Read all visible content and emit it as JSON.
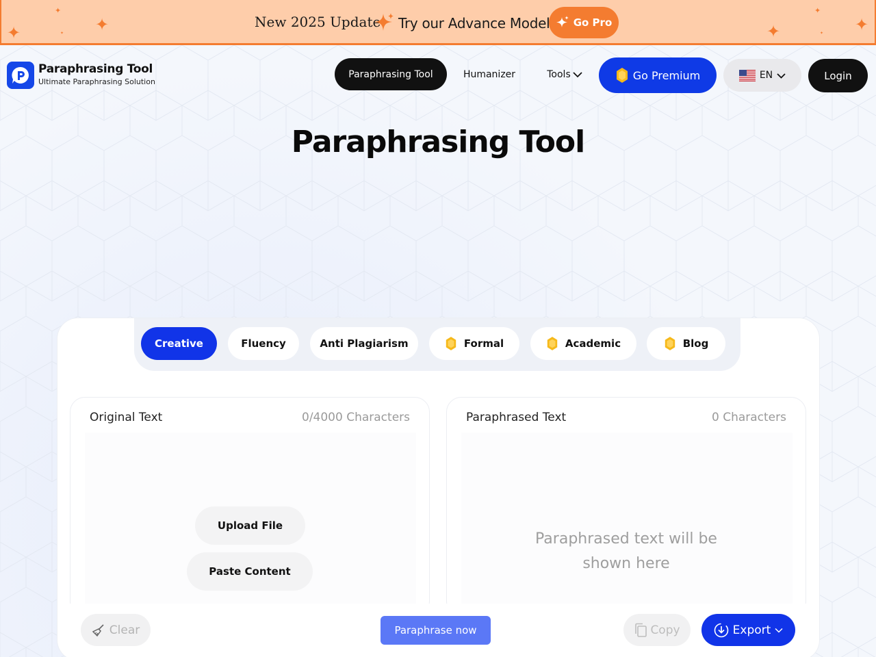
{
  "promo": {
    "update_text": "New 2025 Update:",
    "cta_text": "Try our Advance Model",
    "go_pro_label": "Go Pro"
  },
  "brand": {
    "title": "Paraphrasing Tool",
    "subtitle": "Ultimate Paraphrasing Solution",
    "logo_icon": "chat-bubble-p-icon"
  },
  "nav": {
    "items": [
      {
        "label": "Paraphrasing Tool",
        "active": true
      },
      {
        "label": "Humanizer",
        "active": false
      },
      {
        "label": "Tools",
        "active": false
      }
    ],
    "premium_label": "Go Premium",
    "language_label": "EN",
    "login_label": "Login"
  },
  "page_title": "Paraphrasing Tool",
  "modes": [
    {
      "label": "Creative",
      "active": true,
      "premium": false
    },
    {
      "label": "Fluency",
      "active": false,
      "premium": false
    },
    {
      "label": "Anti Plagiarism",
      "active": false,
      "premium": false
    },
    {
      "label": "Formal",
      "active": false,
      "premium": true
    },
    {
      "label": "Academic",
      "active": false,
      "premium": true
    },
    {
      "label": "Blog",
      "active": false,
      "premium": true
    }
  ],
  "input_panel": {
    "title": "Original Text",
    "count": "0/4000 Characters",
    "upload_label": "Upload File",
    "paste_label": "Paste Content"
  },
  "output_panel": {
    "title": "Paraphrased Text",
    "count": "0 Characters",
    "placeholder": "Paraphrased text will be shown here"
  },
  "actions": {
    "clear_label": "Clear",
    "paraphrase_label": "Paraphrase now",
    "copy_label": "Copy",
    "export_label": "Export"
  },
  "colors": {
    "primary": "#1134e8",
    "promo_bg": "#fecdaa",
    "promo_accent": "#f47c30",
    "dark": "#111111"
  }
}
